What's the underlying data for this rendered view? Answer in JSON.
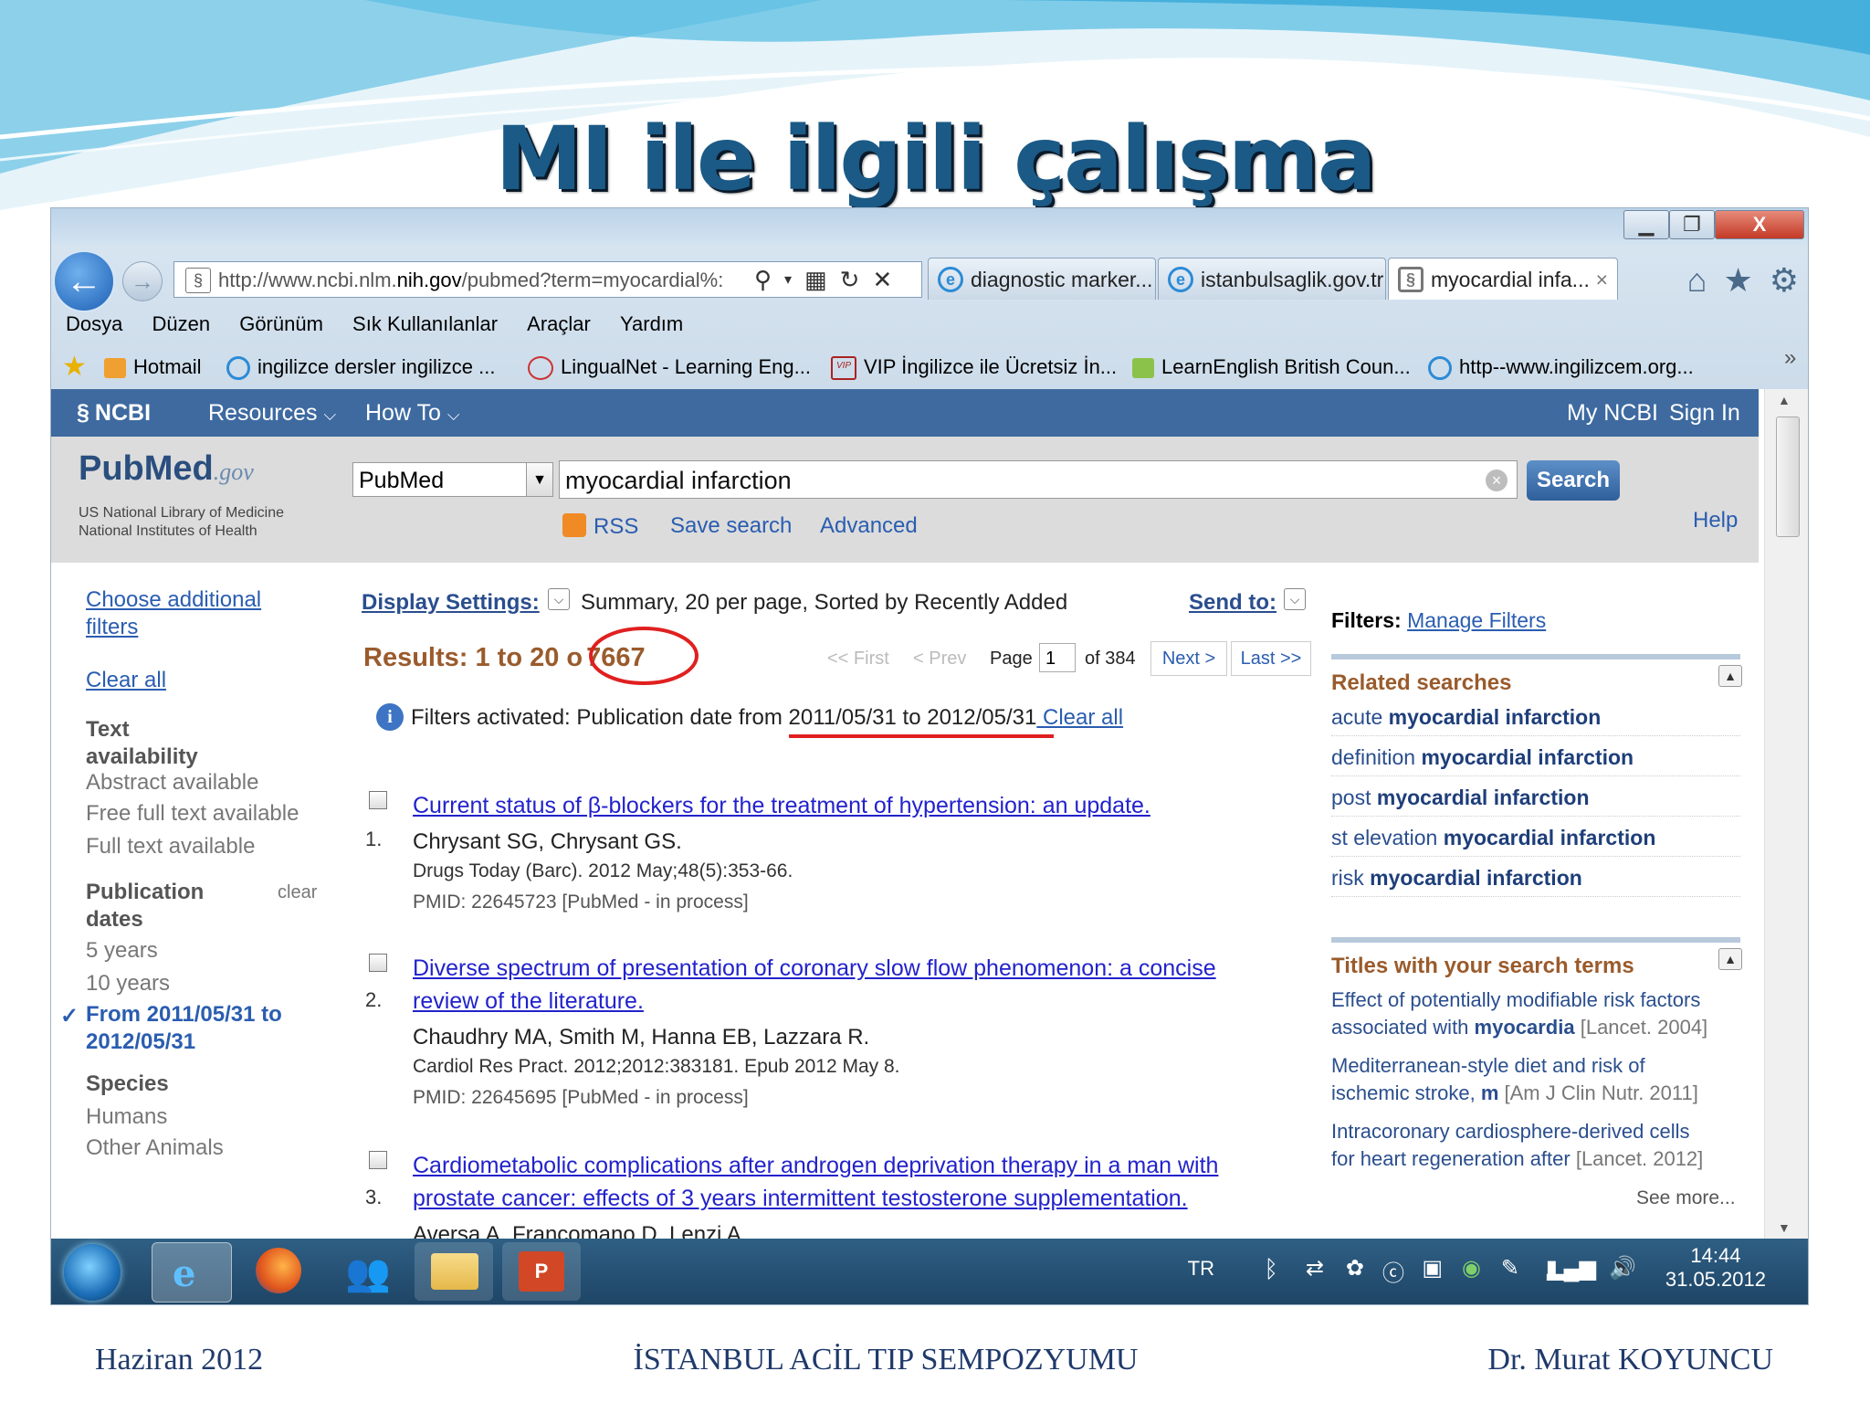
{
  "slide": {
    "title": "MI ile ilgili çalışma",
    "footer_left": "Haziran 2012",
    "footer_center": "İSTANBUL ACİL TIP SEMPOZYUMU",
    "footer_right": "Dr. Murat KOYUNCU"
  },
  "browser": {
    "url_prefix": "http://www.ncbi.nlm.",
    "url_host": "nih.gov",
    "url_suffix": "/pubmed?term=myocardial%:",
    "tabs": [
      {
        "label": "diagnostic marker...",
        "icon": "ie-icon",
        "active": false
      },
      {
        "label": "istanbulsaglik.gov.tr",
        "icon": "ie-icon",
        "active": false
      },
      {
        "label": "myocardial infa...",
        "icon": "ncbi-icon",
        "active": true
      }
    ],
    "menu": [
      "Dosya",
      "Düzen",
      "Görünüm",
      "Sık Kullanılanlar",
      "Araçlar",
      "Yardım"
    ],
    "favorites": [
      {
        "label": "Hotmail",
        "icon": "mail-icon"
      },
      {
        "label": "ingilizce dersler  ingilizce ...",
        "icon": "ie-icon"
      },
      {
        "label": "LingualNet - Learning Eng...",
        "icon": "globe-icon"
      },
      {
        "label": "VIP İngilizce ile Ücretsiz İn...",
        "icon": "vip-icon"
      },
      {
        "label": "LearnEnglish  British Coun...",
        "icon": "learnenglish-icon"
      },
      {
        "label": "http--www.ingilizcem.org...",
        "icon": "ie-icon"
      }
    ],
    "overflow": "»",
    "tab_close": "×",
    "window_close": "X"
  },
  "ncbi": {
    "logo": "NCBI",
    "resources": "Resources",
    "howto": "How To",
    "my_ncbi": "My NCBI",
    "sign_in": "Sign In",
    "pubmed_logo": "PubMed",
    "pubmed_gov": ".gov",
    "lib1": "US National Library of Medicine",
    "lib2": "National Institutes of Health",
    "db": "PubMed",
    "query": "myocardial infarction",
    "search": "Search",
    "rss": "RSS",
    "save_search": "Save search",
    "advanced": "Advanced",
    "help": "Help"
  },
  "sidebar": {
    "choose1": "Choose additional",
    "choose2": "filters",
    "clear_all": "Clear all",
    "text_h1": "Text",
    "text_h2": "availability",
    "text_items": [
      "Abstract available",
      "Free full text available",
      "Full text available"
    ],
    "pub_h1": "Publication",
    "pub_h2": "dates",
    "pub_clear": "clear",
    "pub_items": [
      "5 years",
      "10 years"
    ],
    "pub_selected_check": "✓",
    "pub_selected1": "From 2011/05/31 to",
    "pub_selected2": "2012/05/31",
    "species_h": "Species",
    "species_items": [
      "Humans",
      "Other Animals"
    ]
  },
  "results": {
    "display_settings": "Display Settings:",
    "display_summary": "Summary, 20 per page, Sorted by Recently Added",
    "send_to": "Send to:",
    "results_label": "Results: 1 to 20 o",
    "results_count": "7667",
    "first": "<< First",
    "prev": "< Prev",
    "page_label": "Page",
    "page_value": "1",
    "of_pages": "of 384",
    "next": "Next >",
    "last": "Last >>",
    "filters_activated": "Filters activated: Publication date from ",
    "filters_dates": "2011/05/31 to 2012/05/31",
    "filters_clear": " Clear all",
    "items": [
      {
        "num": "1.",
        "title1": "Current status of β-blockers for the treatment of hypertension: an update.",
        "title2": "",
        "authors": "Chrysant SG, Chrysant GS.",
        "journal": "Drugs Today (Barc). 2012 May;48(5):353-66.",
        "pmid": "PMID: 22645723 [PubMed - in process]"
      },
      {
        "num": "2.",
        "title1": "Diverse spectrum of presentation of coronary slow flow phenomenon: a concise",
        "title2": "review of the literature.",
        "authors": "Chaudhry MA, Smith M, Hanna EB, Lazzara R.",
        "journal": "Cardiol Res Pract. 2012;2012:383181. Epub 2012 May 8.",
        "pmid": "PMID: 22645695 [PubMed - in process]"
      },
      {
        "num": "3.",
        "title1": "Cardiometabolic complications after androgen deprivation therapy in a man with",
        "title2": "prostate cancer: effects of 3 years intermittent testosterone supplementation.",
        "authors": "Aversa A, Francomano D, Lenzi A.",
        "journal": "",
        "pmid": ""
      }
    ]
  },
  "right_panel": {
    "filters_label": "Filters:",
    "manage_filters": "Manage Filters",
    "related_h": "Related searches",
    "related": [
      {
        "pre": "acute ",
        "bold": "myocardial infarction"
      },
      {
        "pre": "definition ",
        "bold": "myocardial infarction"
      },
      {
        "pre": "post ",
        "bold": "myocardial infarction"
      },
      {
        "pre": "st elevation ",
        "bold": "myocardial infarction"
      },
      {
        "pre": "risk ",
        "bold": "myocardial infarction"
      }
    ],
    "titles_h": "Titles with your search terms",
    "titles": [
      {
        "l1": "Effect of potentially modifiable risk factors",
        "l2": "associated with ",
        "b": "myocardia",
        "src": "[Lancet. 2004]"
      },
      {
        "l1": "Mediterranean-style diet and risk of",
        "l2": "ischemic stroke, ",
        "b": "m",
        "src": "[Am J Clin Nutr. 2011]"
      },
      {
        "l1": "Intracoronary cardiosphere-derived cells",
        "l2": "for heart regeneration after ",
        "b": "",
        "src": "[Lancet. 2012]"
      }
    ],
    "see_more": "See more..."
  },
  "taskbar": {
    "lang": "TR",
    "time": "14:44",
    "date": "31.05.2012"
  },
  "colors": {
    "ncbi_bar": "#3e6aa0",
    "highlight_red": "#e02020",
    "slide_title": "#1b5a86"
  }
}
